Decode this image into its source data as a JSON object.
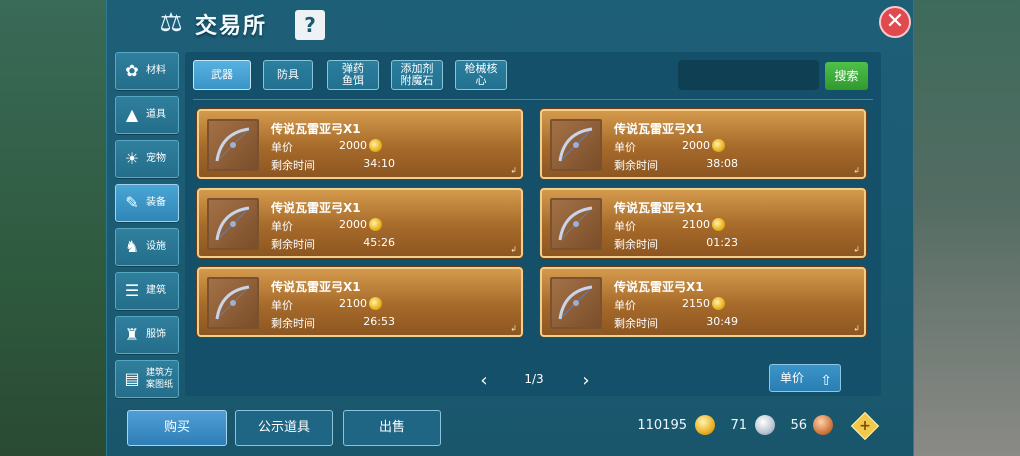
{
  "window": {
    "title": "交易所",
    "help_icon": "?",
    "close_icon": "✕"
  },
  "sidebar": {
    "items": [
      {
        "label": "材料",
        "icon": "materials-icon",
        "glyph": "✿"
      },
      {
        "label": "道具",
        "icon": "tool-icon",
        "glyph": "▲"
      },
      {
        "label": "宠物",
        "icon": "paw-icon",
        "glyph": "☀"
      },
      {
        "label": "装备",
        "icon": "equipment-icon",
        "glyph": "✎",
        "active": true
      },
      {
        "label": "设施",
        "icon": "facility-icon",
        "glyph": "♞"
      },
      {
        "label": "建筑",
        "icon": "building-icon",
        "glyph": "☰"
      },
      {
        "label": "服饰",
        "icon": "clothing-icon",
        "glyph": "♜"
      },
      {
        "label": "建筑方案图纸",
        "icon": "blueprint-icon",
        "glyph": "▤"
      }
    ]
  },
  "tabs": [
    {
      "line1": "武器",
      "line2": "",
      "active": true
    },
    {
      "line1": "防具",
      "line2": ""
    },
    {
      "line1": "弹药",
      "line2": "鱼饵"
    },
    {
      "line1": "添加剂",
      "line2": "附魔石"
    },
    {
      "line1": "枪械核",
      "line2": "心"
    }
  ],
  "search": {
    "placeholder": "",
    "button_label": "搜索"
  },
  "listings": [
    {
      "name": "传说瓦雷亚弓X1",
      "price_label": "单价",
      "price": "2000",
      "time_label": "剩余时间",
      "time": "34:10"
    },
    {
      "name": "传说瓦雷亚弓X1",
      "price_label": "单价",
      "price": "2000",
      "time_label": "剩余时间",
      "time": "38:08"
    },
    {
      "name": "传说瓦雷亚弓X1",
      "price_label": "单价",
      "price": "2000",
      "time_label": "剩余时间",
      "time": "45:26"
    },
    {
      "name": "传说瓦雷亚弓X1",
      "price_label": "单价",
      "price": "2100",
      "time_label": "剩余时间",
      "time": "01:23"
    },
    {
      "name": "传说瓦雷亚弓X1",
      "price_label": "单价",
      "price": "2100",
      "time_label": "剩余时间",
      "time": "26:53"
    },
    {
      "name": "传说瓦雷亚弓X1",
      "price_label": "单价",
      "price": "2150",
      "time_label": "剩余时间",
      "time": "30:49"
    }
  ],
  "pagination": {
    "text": "1/3",
    "prev": "‹",
    "next": "›"
  },
  "sort": {
    "label": "单价",
    "arrow": "⇧"
  },
  "bottom": {
    "buy_label": "购买",
    "public_label": "公示道具",
    "sell_label": "出售"
  },
  "currency": {
    "gold": "110195",
    "silver": "71",
    "copper": "56",
    "add": "+"
  },
  "colors": {
    "panel": "#1b5b72",
    "card": "#b47634",
    "accent_green": "#3fae3a",
    "close": "#e0494e"
  }
}
